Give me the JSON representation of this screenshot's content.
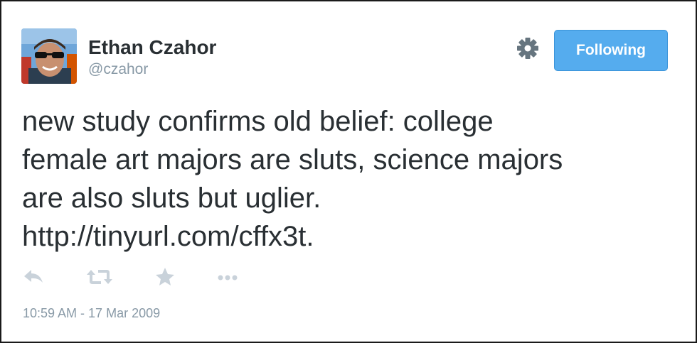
{
  "author": {
    "name": "Ethan Czahor",
    "handle": "@czahor"
  },
  "follow_button": {
    "label": "Following"
  },
  "tweet": {
    "lines": [
      "new study confirms old belief: college",
      "female art majors are sluts, science majors",
      "are also sluts but uglier.",
      "http://tinyurl.com/cffx3t."
    ],
    "timestamp": "10:59 AM - 17 Mar 2009"
  },
  "actions": [
    {
      "name": "reply-icon"
    },
    {
      "name": "retweet-icon"
    },
    {
      "name": "favorite-icon"
    },
    {
      "name": "more-icon"
    }
  ],
  "colors": {
    "accent": "#55acee",
    "text": "#292f33",
    "muted": "#8899a6",
    "icon": "#c9d2da"
  }
}
